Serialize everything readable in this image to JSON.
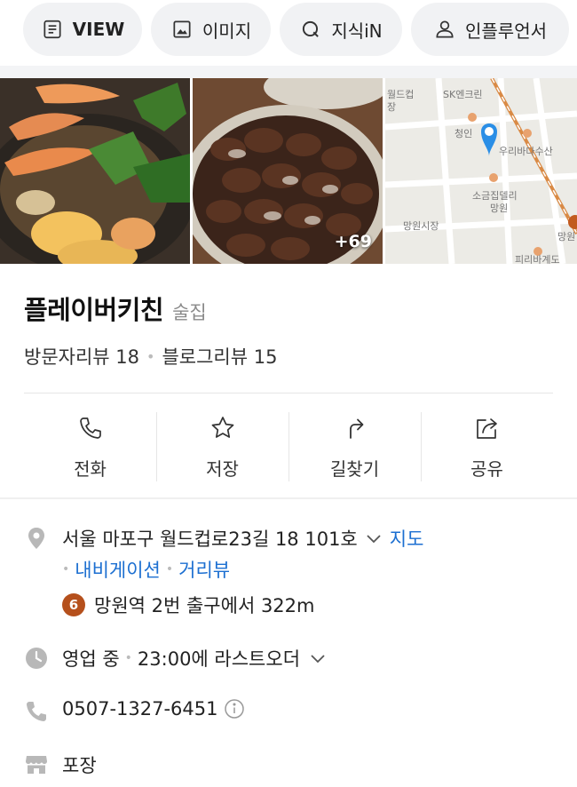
{
  "tabs": [
    {
      "label": "VIEW",
      "icon": "view-icon"
    },
    {
      "label": "이미지",
      "icon": "image-icon"
    },
    {
      "label": "지식iN",
      "icon": "kin-icon"
    },
    {
      "label": "인플루언서",
      "icon": "person-icon"
    }
  ],
  "photos": {
    "more_count": "+69",
    "map_labels": [
      "월드컵",
      "장",
      "SK엔크린",
      "청인",
      "우리바다수산",
      "소금집델리",
      "망원",
      "망원시장",
      "망원",
      "피리바계도"
    ]
  },
  "place": {
    "name": "플레이버키친",
    "category": "술집",
    "visitor_reviews": "방문자리뷰 18",
    "blog_reviews": "블로그리뷰 15"
  },
  "actions": [
    {
      "label": "전화",
      "icon": "phone-icon"
    },
    {
      "label": "저장",
      "icon": "star-icon"
    },
    {
      "label": "길찾기",
      "icon": "directions-icon"
    },
    {
      "label": "공유",
      "icon": "share-icon"
    }
  ],
  "info": {
    "address": "서울 마포구 월드컵로23길 18 101호",
    "map_link": "지도",
    "navigation_link": "내비게이션",
    "streetview_link": "거리뷰",
    "subway_line": "6",
    "subway_text": "망원역 2번 출구에서 322m",
    "hours_status": "영업 중",
    "hours_text": "23:00에 라스트오더",
    "phone": "0507-1327-6451",
    "service": "포장"
  },
  "colors": {
    "link": "#1c6fd1",
    "line6": "#b5501c",
    "icon_gray": "#b8b8b8"
  }
}
